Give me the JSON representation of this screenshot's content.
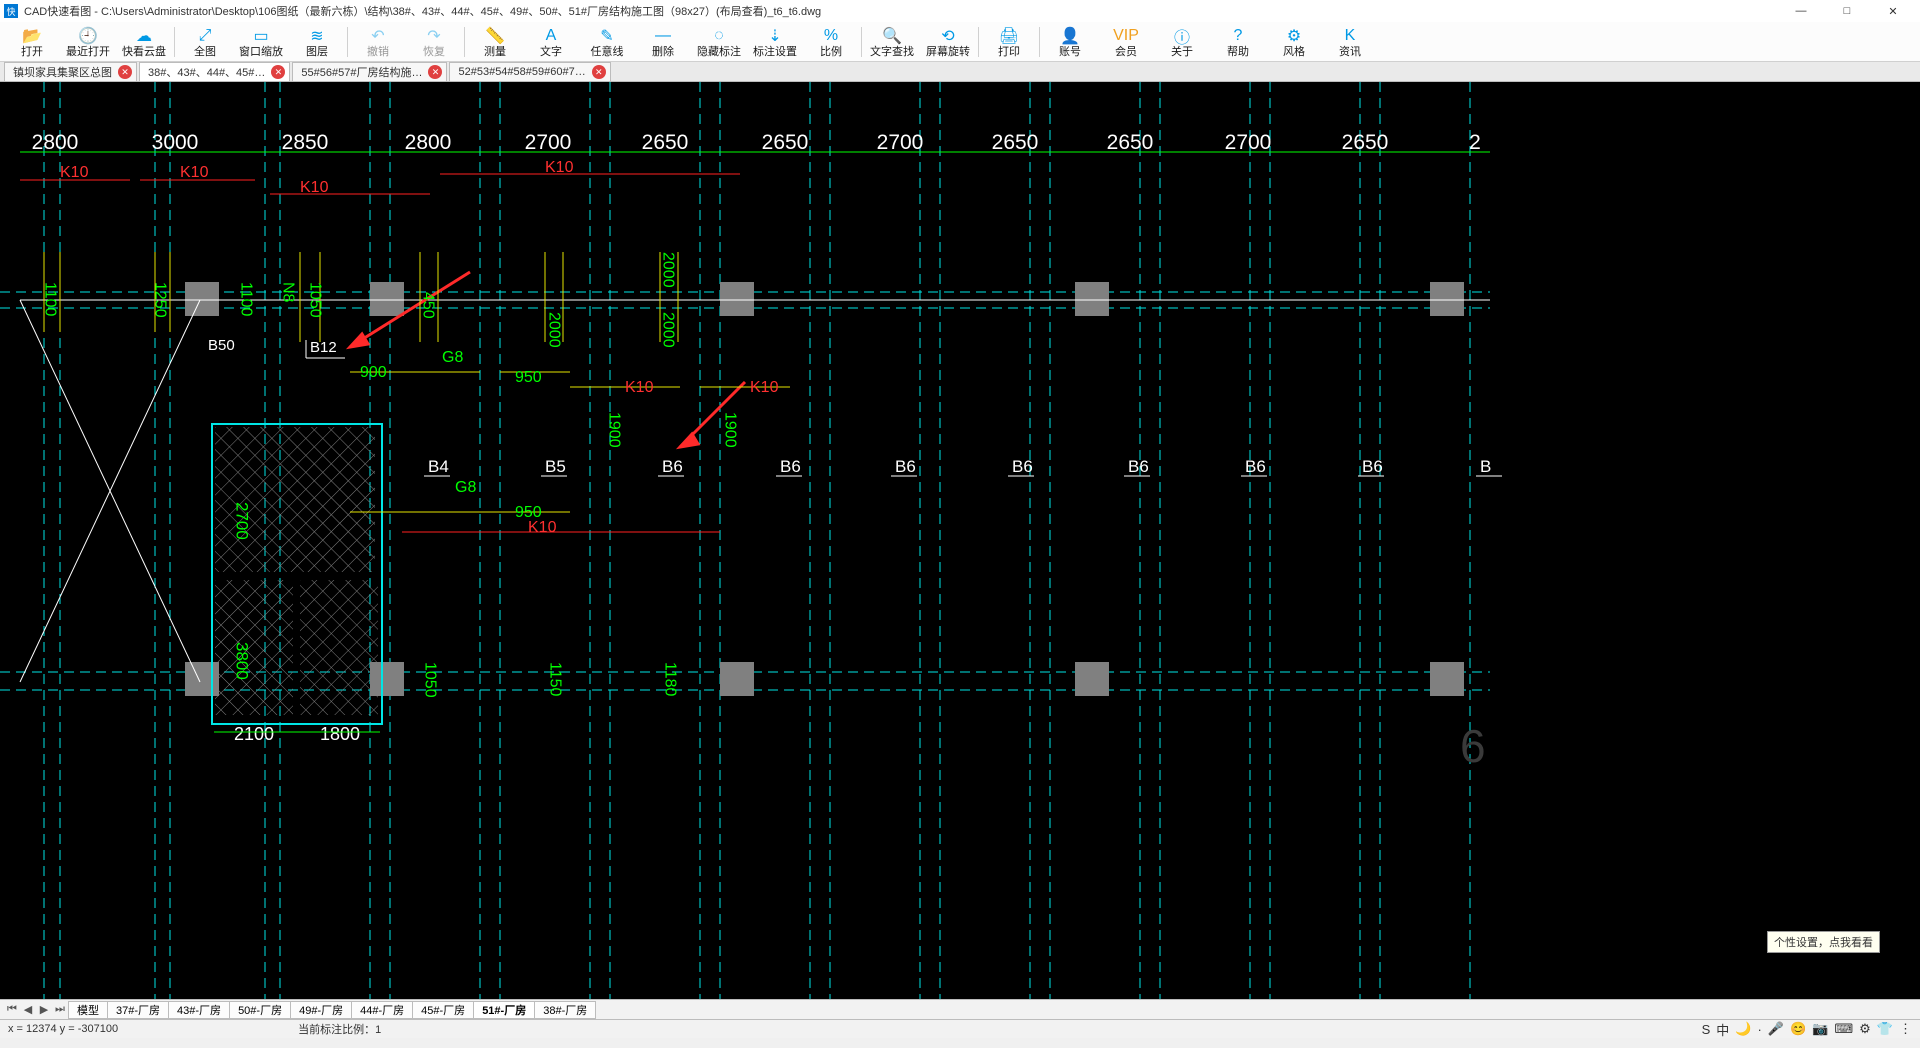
{
  "window": {
    "app_icon": "快",
    "title": "CAD快速看图 - C:\\Users\\Administrator\\Desktop\\106图纸（最新六栋）\\结构\\38#、43#、44#、45#、49#、50#、51#厂房结构施工图（98x27）(布局查看)_t6_t6.dwg",
    "min": "—",
    "max": "□",
    "close": "✕"
  },
  "toolbar": [
    {
      "icon": "📂",
      "label": "打开"
    },
    {
      "icon": "🕘",
      "label": "最近打开"
    },
    {
      "icon": "☁",
      "label": "快看云盘"
    },
    {
      "sep": true
    },
    {
      "icon": "⤢",
      "label": "全图"
    },
    {
      "icon": "▭",
      "label": "窗口缩放"
    },
    {
      "icon": "≋",
      "label": "图层"
    },
    {
      "sep": true
    },
    {
      "icon": "↶",
      "label": "撤销",
      "disabled": true
    },
    {
      "icon": "↷",
      "label": "恢复",
      "disabled": true
    },
    {
      "sep": true
    },
    {
      "icon": "📏",
      "label": "测量"
    },
    {
      "icon": "A",
      "label": "文字"
    },
    {
      "icon": "✎",
      "label": "任意线"
    },
    {
      "icon": "—",
      "label": "删除"
    },
    {
      "icon": "◌",
      "label": "隐藏标注"
    },
    {
      "icon": "⇣",
      "label": "标注设置"
    },
    {
      "icon": "%",
      "label": "比例"
    },
    {
      "sep": true
    },
    {
      "icon": "🔍",
      "label": "文字查找"
    },
    {
      "icon": "⟲",
      "label": "屏幕旋转"
    },
    {
      "sep": true
    },
    {
      "icon": "🖨",
      "label": "打印"
    },
    {
      "sep": true
    },
    {
      "icon": "👤",
      "label": "账号"
    },
    {
      "icon": "VIP",
      "label": "会员",
      "vip": true
    },
    {
      "icon": "ⓘ",
      "label": "关于"
    },
    {
      "icon": "?",
      "label": "帮助"
    },
    {
      "icon": "⚙",
      "label": "风格"
    },
    {
      "icon": "K",
      "label": "资讯"
    }
  ],
  "doc_tabs": [
    {
      "label": "镇坝家具集聚区总图",
      "active": false
    },
    {
      "label": "38#、43#、44#、45#…",
      "active": true
    },
    {
      "label": "55#56#57#厂房结构施…",
      "active": false
    },
    {
      "label": "52#53#54#58#59#60#7…",
      "active": false
    }
  ],
  "drawing": {
    "top_dims": [
      "2800",
      "3000",
      "2850",
      "2800",
      "2700",
      "2650",
      "2650",
      "2700",
      "2650",
      "2650",
      "2700",
      "2650",
      "2"
    ],
    "k10_top": [
      "K10",
      "K10",
      "K10",
      "K10"
    ],
    "b_row": [
      "B4",
      "B5",
      "B6",
      "B6",
      "B6",
      "B6",
      "B6",
      "B6",
      "B6",
      "B"
    ],
    "g_labels": [
      "G8",
      "G8"
    ],
    "mid_dims": [
      "900",
      "950",
      "950"
    ],
    "k10_mid": [
      "K10",
      "K10",
      "K10"
    ],
    "v_dims_small": [
      "1100",
      "1250",
      "1100",
      "1050",
      "450",
      "N8",
      "2000",
      "2000",
      "2000",
      "1900",
      "1900",
      "1050",
      "1150",
      "1180"
    ],
    "b12": "B12",
    "b50": "B50",
    "v_2700": "2700",
    "v_3800": "3800",
    "bottom_dims": [
      "2100",
      "1800"
    ],
    "far_6": "6"
  },
  "layout_tabs": {
    "nav": [
      "⏮",
      "◀",
      "▶",
      "⏭"
    ],
    "tabs": [
      {
        "label": "模型"
      },
      {
        "label": "37#-厂房"
      },
      {
        "label": "43#-厂房"
      },
      {
        "label": "50#-厂房"
      },
      {
        "label": "49#-厂房"
      },
      {
        "label": "44#-厂房"
      },
      {
        "label": "45#-厂房"
      },
      {
        "label": "51#-厂房",
        "active": true
      },
      {
        "label": "38#-厂房"
      }
    ]
  },
  "status": {
    "coords": "x = 12374  y = -307100",
    "scale": "当前标注比例：1",
    "tray": [
      "S",
      "中",
      "🌙",
      "·",
      "🎤",
      "😊",
      "📷",
      "⌨",
      "⚙",
      "👕",
      "⋮"
    ]
  },
  "tooltip": "个性设置，点我看看"
}
